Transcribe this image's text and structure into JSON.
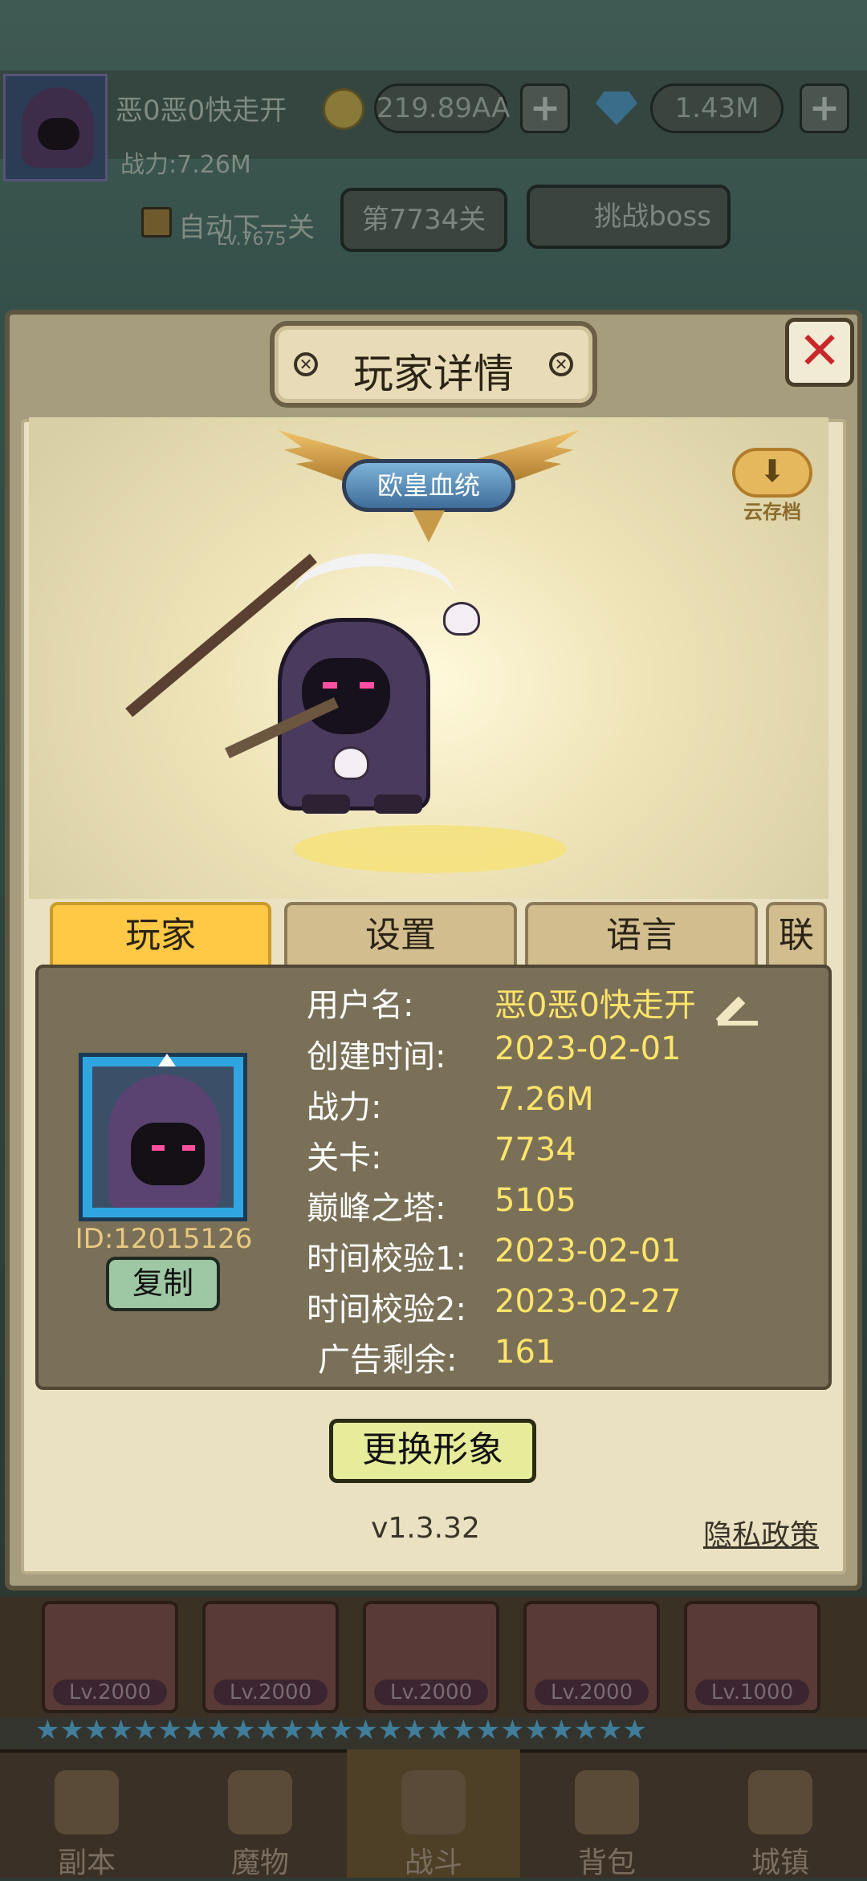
{
  "hud": {
    "player_name": "恶0恶0快走开",
    "power": "战力:7.26M",
    "gold": "219.89AA",
    "gems": "1.43M",
    "auto_next": "自动下一关",
    "stage": "第7734关",
    "challenge_boss": "挑战boss",
    "enemy_level": "Lv.7675"
  },
  "modal": {
    "title": "玩家详情",
    "close_symbol": "✕",
    "title_badge": "欧皇血统",
    "cloud_save": "云存档",
    "tabs": [
      {
        "label": "玩家",
        "active": true
      },
      {
        "label": "设置",
        "active": false
      },
      {
        "label": "语言",
        "active": false
      },
      {
        "label": "联",
        "active": false
      }
    ],
    "player": {
      "id": "ID:12015126",
      "copy": "复制",
      "rows": [
        {
          "label": "用户名:",
          "value": "恶0恶0快走开"
        },
        {
          "label": "创建时间:",
          "value": "2023-02-01"
        },
        {
          "label": "战力:",
          "value": "7.26M"
        },
        {
          "label": "关卡:",
          "value": "7734"
        },
        {
          "label": "巅峰之塔:",
          "value": "5105"
        },
        {
          "label": "时间校验1:",
          "value": "2023-02-01"
        },
        {
          "label": "时间校验2:",
          "value": "2023-02-27"
        },
        {
          "label": "广告剩余:",
          "value": "161"
        }
      ]
    },
    "change_avatar": "更换形象",
    "version": "v1.3.32",
    "privacy": "隐私政策"
  },
  "cards": [
    {
      "level": "Lv.2000"
    },
    {
      "level": "Lv.2000"
    },
    {
      "level": "Lv.2000"
    },
    {
      "level": "Lv.2000"
    },
    {
      "level": "Lv.1000"
    }
  ],
  "nav": [
    {
      "label": "副本",
      "active": false
    },
    {
      "label": "魔物",
      "active": false
    },
    {
      "label": "战斗",
      "active": true
    },
    {
      "label": "背包",
      "active": false
    },
    {
      "label": "城镇",
      "active": false
    }
  ],
  "colors": {
    "accent_yellow": "#ffe46a",
    "tab_active": "#ffc845",
    "close_red": "#c8282a",
    "id_text": "#e8c880"
  }
}
